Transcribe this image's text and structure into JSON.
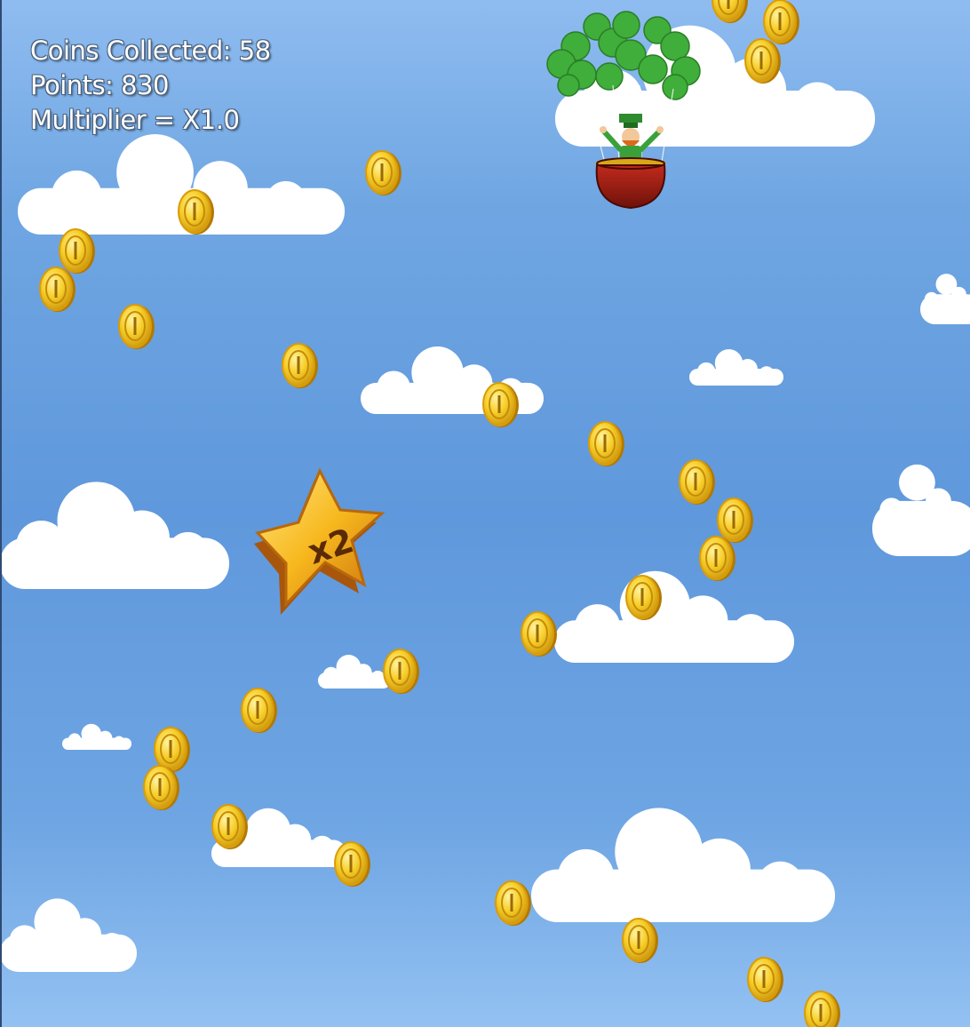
{
  "hud": {
    "coins_label": "Coins Collected: 58",
    "points_label": "Points: 830",
    "multiplier_label": "Multiplier = X1.0"
  },
  "powerup": {
    "type": "star-multiplier",
    "label": "x2"
  },
  "colors": {
    "sky_top": "#8fbcf0",
    "sky_mid": "#5f98dc",
    "cloud": "#ffffff",
    "coin": "#f5c518",
    "coin_rim": "#c8900a",
    "star": "#f7b81e",
    "pot": "#9e1c12",
    "clover": "#3fae3a"
  },
  "icons": {
    "coin": "gold-coin-icon",
    "star": "x2-star-icon",
    "balloon": "leprechaun-pot-balloon"
  }
}
